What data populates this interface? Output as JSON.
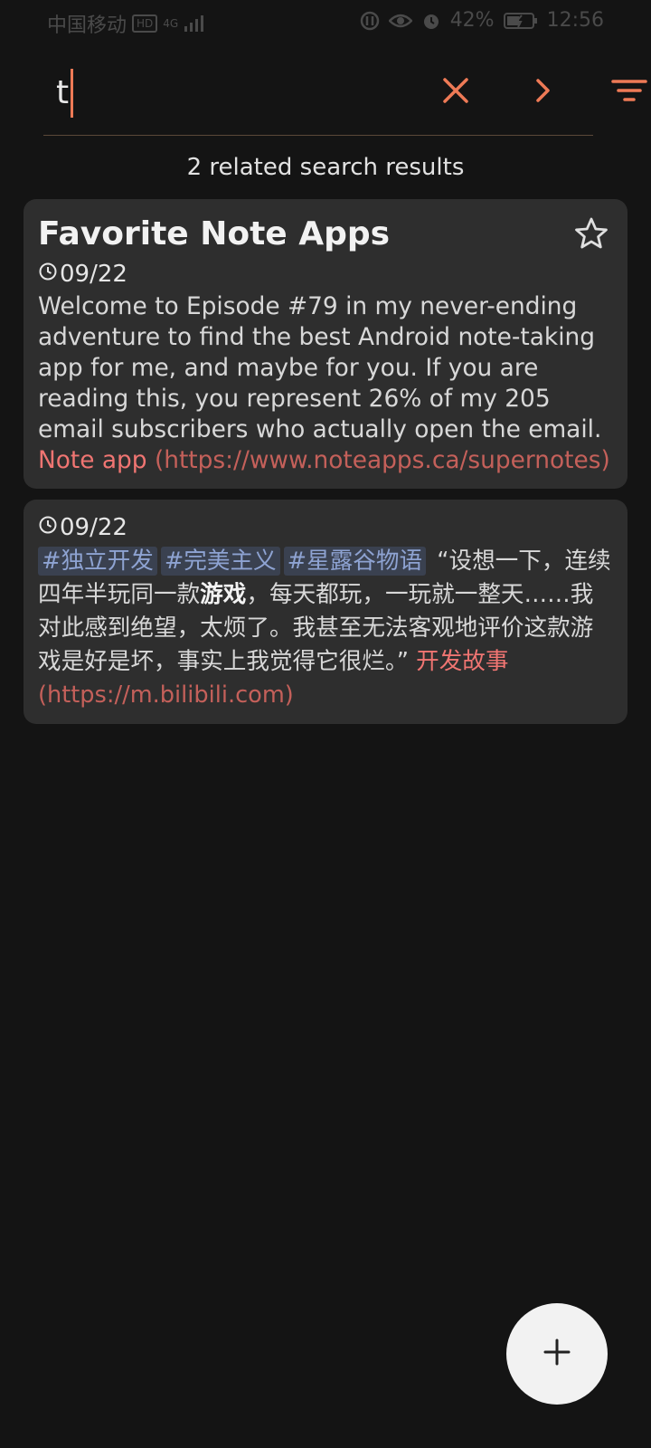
{
  "status_bar": {
    "carrier": "中国移动",
    "hd_badge": "HD",
    "network": "4G",
    "battery": "42%",
    "time": "12:56"
  },
  "search": {
    "query": "t",
    "clear_icon": "close-icon",
    "next_icon": "chevron-right-icon",
    "filter_icon": "filter-icon"
  },
  "results": {
    "count_text": "2 related search results"
  },
  "notes": [
    {
      "title": "Favorite Note Apps",
      "date": "09/22",
      "starred": false,
      "body": "Welcome to Episode #79 in my never-ending adventure to find the best Android note-taking app for me, and maybe for you. If you are reading this, you represent 26% of my 205 email subscribers who actually open the email. ",
      "link_label": "Note app",
      "link_url": "(https://www.noteapps.ca/supernotes)"
    },
    {
      "date": "09/22",
      "tags": [
        "#独立开发",
        "#完美主义",
        "#星露谷物语"
      ],
      "body_before": " “设想一下，连续四年半玩同一款",
      "body_highlight": "游戏",
      "body_after": "，每天都玩，一玩就一整天……我对此感到绝望，太烦了。我甚至无法客观地评价这款游戏是好是坏，事实上我觉得它很烂。” ",
      "link_label": "开发故事",
      "link_url": "(https://m.bilibili.com)"
    }
  ],
  "fab": {
    "icon": "plus-icon"
  },
  "colors": {
    "background": "#141414",
    "card": "#2e2e2e",
    "accent": "#ee7a56",
    "tag_bg": "#3a4150",
    "tag_text": "#8ea3d2",
    "link": "#f07572"
  }
}
